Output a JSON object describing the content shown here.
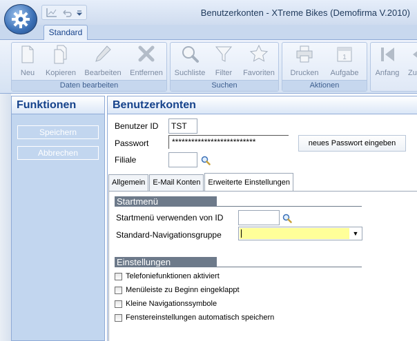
{
  "window": {
    "title": "Benutzerkonten - XTreme Bikes (Demofirma V.2010)"
  },
  "ribbon": {
    "tab": "Standard",
    "groups": [
      {
        "label": "Daten bearbeiten",
        "buttons": [
          {
            "label": "Neu",
            "icon": "new-document-icon"
          },
          {
            "label": "Kopieren",
            "icon": "copy-icon"
          },
          {
            "label": "Bearbeiten",
            "icon": "pencil-icon"
          },
          {
            "label": "Entfernen",
            "icon": "delete-x-icon"
          }
        ]
      },
      {
        "label": "Suchen",
        "buttons": [
          {
            "label": "Suchliste",
            "icon": "magnifier-icon"
          },
          {
            "label": "Filter",
            "icon": "funnel-icon"
          },
          {
            "label": "Favoriten",
            "icon": "star-icon"
          }
        ]
      },
      {
        "label": "Aktionen",
        "buttons": [
          {
            "label": "Drucken",
            "icon": "printer-icon"
          },
          {
            "label": "Aufgabe",
            "icon": "calendar-icon"
          }
        ]
      },
      {
        "label": "",
        "buttons": [
          {
            "label": "Anfang",
            "icon": "first-icon"
          },
          {
            "label": "Zu",
            "icon": "prev-icon"
          }
        ]
      }
    ]
  },
  "sidebar": {
    "title": "Funktionen",
    "buttons": [
      "Speichern",
      "Abbrechen"
    ]
  },
  "main": {
    "title": "Benutzerkonten",
    "fields": {
      "user_id_label": "Benutzer ID",
      "user_id_value": "TST",
      "password_label": "Passwort",
      "password_value": "**************************",
      "branch_label": "Filiale",
      "branch_value": "",
      "new_password_button": "neues Passwort eingeben"
    },
    "tabs": [
      "Allgemein",
      "E-Mail Konten",
      "Erweiterte Einstellungen"
    ],
    "active_tab": "Erweiterte Einstellungen",
    "startmenu": {
      "heading": "Startmenü",
      "use_from_id_label": "Startmenü verwenden von ID",
      "use_from_id_value": "",
      "nav_group_label": "Standard-Navigationsgruppe",
      "nav_group_value": ""
    },
    "settings": {
      "heading": "Einstellungen",
      "checkboxes": [
        {
          "label": "Telefoniefunktionen aktiviert",
          "checked": false
        },
        {
          "label": "Menüleiste zu Beginn eingeklappt",
          "checked": false
        },
        {
          "label": "Kleine Navigationssymbole",
          "checked": false
        },
        {
          "label": "Fenstereinstellungen automatisch speichern",
          "checked": false
        }
      ]
    }
  },
  "colors": {
    "accent": "#15428b",
    "sidebar_bg": "#c2d6ef",
    "highlight_field": "#ffff99",
    "section_bar": "#6d7a8a"
  }
}
